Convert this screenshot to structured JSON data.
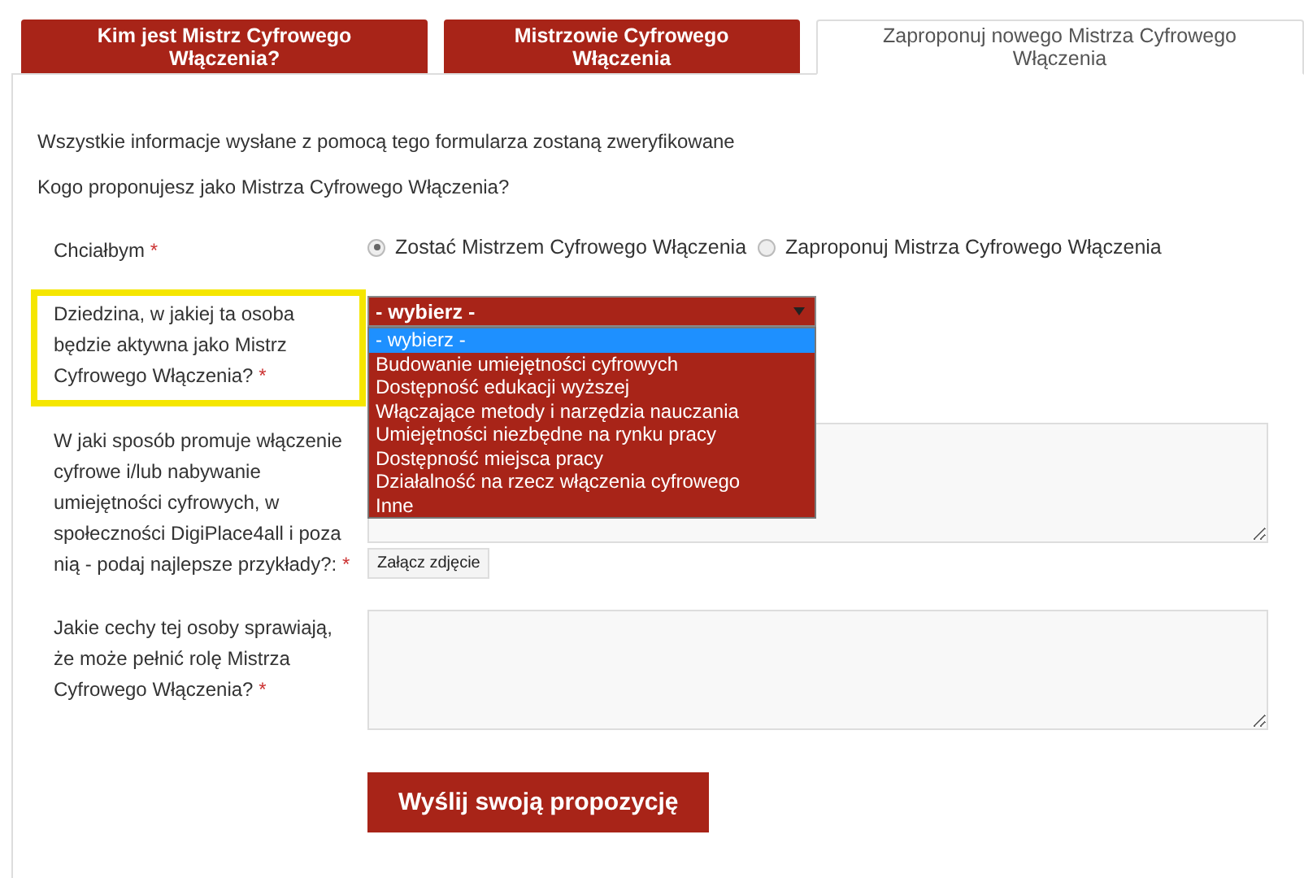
{
  "tabs": [
    {
      "label": "Kim jest Mistrz Cyfrowego Włączenia?",
      "selected": false
    },
    {
      "label": "Mistrzowie Cyfrowego Włączenia",
      "selected": false
    },
    {
      "label": "Zaproponuj nowego Mistrza Cyfrowego Włączenia",
      "selected": true
    }
  ],
  "intro": [
    "Wszystkie informacje wysłane z pomocą tego formularza zostaną zweryfikowane",
    "Kogo proponujesz jako Mistrza Cyfrowego Włączenia?"
  ],
  "fields": [
    {
      "kind": "radio",
      "label": "Chciałbym",
      "required": "*",
      "highlighted": false,
      "options": [
        {
          "label": "Zostać Mistrzem Cyfrowego Włączenia",
          "selected": true
        },
        {
          "label": "Zaproponuj Mistrza Cyfrowego Włączenia",
          "selected": false
        }
      ]
    },
    {
      "kind": "select",
      "label": "Dziedzina, w jakiej ta osoba będzie aktywna jako Mistrz Cyfrowego Włączenia?",
      "required": "*",
      "highlighted": true,
      "value": "- wybierz -",
      "expanded": true,
      "options": [
        {
          "label": "- wybierz -",
          "selected": true
        },
        {
          "label": "Budowanie umiejętności cyfrowych",
          "selected": false
        },
        {
          "label": "Dostępność edukacji wyższej",
          "selected": false
        },
        {
          "label": "Włączające metody i narzędzia nauczania",
          "selected": false
        },
        {
          "label": "Umiejętności niezbędne na rynku pracy",
          "selected": false
        },
        {
          "label": "Dostępność miejsca pracy",
          "selected": false
        },
        {
          "label": "Działalność na rzecz włączenia cyfrowego",
          "selected": false
        },
        {
          "label": "Inne",
          "selected": false
        }
      ]
    },
    {
      "kind": "textarea",
      "label": "W jaki sposób promuje włączenie cyfrowe i/lub nabywanie umiejętności cyfrowych, w społeczności DigiPlace4all i poza nią - podaj najlepsze przykłady?:",
      "required": "*",
      "highlighted": false,
      "button": "Załącz zdjęcie"
    },
    {
      "kind": "textarea",
      "label": "Jakie cechy tej osoby sprawiają, że może pełnić rolę Mistrza Cyfrowego Włączenia?",
      "required": "*",
      "highlighted": false
    }
  ],
  "submit": "Wyślij swoją propozycję"
}
